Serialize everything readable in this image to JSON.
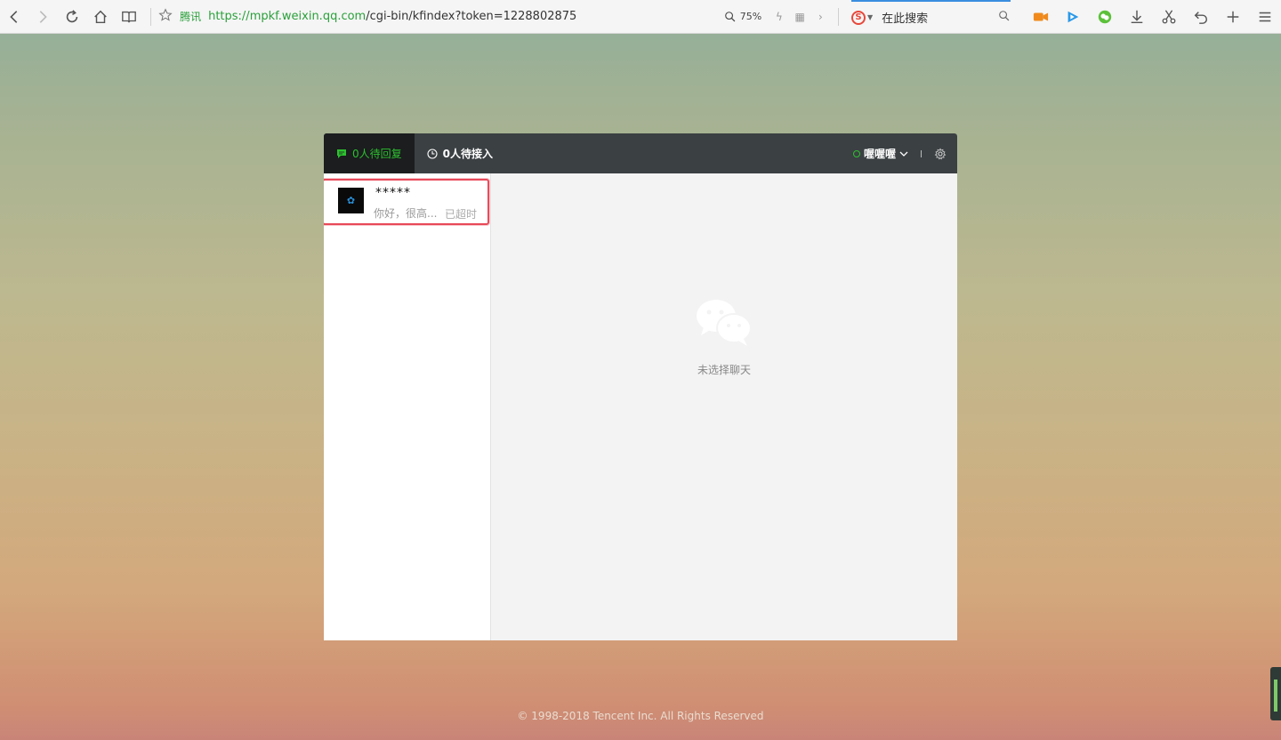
{
  "browser": {
    "site_name": "腾讯",
    "url_scheme": "https://",
    "url_domain": "mpkf.weixin.qq.com",
    "url_path": "/cgi-bin/kfindex?token=1228802875",
    "zoom": "75%",
    "search_placeholder": "在此搜索",
    "search_engine_icon": "S"
  },
  "app": {
    "tabs": [
      {
        "label": "0人待回复",
        "icon": "chat-icon"
      },
      {
        "label": "0人待接入",
        "icon": "clock-icon"
      }
    ],
    "agent_name": "喔喔喔",
    "conversations": [
      {
        "name": "*****",
        "preview": "你好，很高...",
        "status": "已超时"
      }
    ],
    "empty_text": "未选择聊天"
  },
  "footer": "© 1998-2018 Tencent Inc. All Rights Reserved",
  "colors": {
    "accent_green": "#2cc02f",
    "header_bg": "#3b4043",
    "highlight_border": "#e84a5a"
  }
}
